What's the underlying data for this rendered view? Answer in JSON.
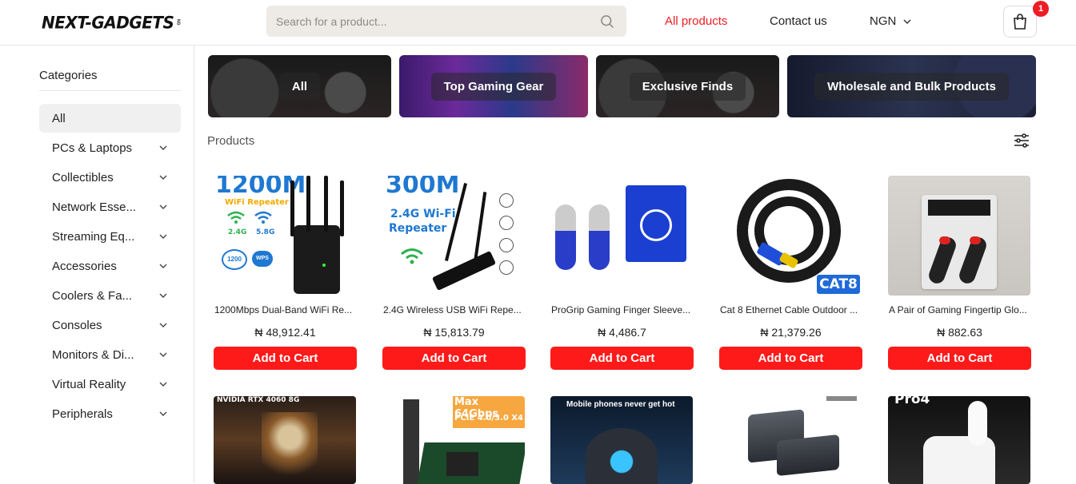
{
  "header": {
    "logo_text": "NEXT-GADGETS",
    "logo_sub": "NG",
    "search_placeholder": "Search for a product...",
    "nav": {
      "all_products": "All products",
      "contact_us": "Contact us"
    },
    "currency": "NGN",
    "cart_count": "1",
    "accent_color": "#ee1c25"
  },
  "sidebar": {
    "title": "Categories",
    "items": [
      {
        "label": "All"
      },
      {
        "label": "PCs & Laptops"
      },
      {
        "label": "Collectibles"
      },
      {
        "label": "Network Esse..."
      },
      {
        "label": "Streaming Eq..."
      },
      {
        "label": "Accessories"
      },
      {
        "label": "Coolers & Fa..."
      },
      {
        "label": "Consoles"
      },
      {
        "label": "Monitors & Di..."
      },
      {
        "label": "Virtual Reality"
      },
      {
        "label": "Peripherals"
      }
    ]
  },
  "banners": [
    {
      "label": "All"
    },
    {
      "label": "Top Gaming Gear"
    },
    {
      "label": "Exclusive Finds"
    },
    {
      "label": "Wholesale and Bulk Products"
    }
  ],
  "products_label": "Products",
  "add_to_cart_label": "Add to Cart",
  "products": [
    {
      "name": "1200Mbps Dual-Band WiFi Re...",
      "price": "₦ 48,912.41",
      "img_text": "1200M",
      "img_sub": "WiFi Repeater",
      "img_24": "2.4G",
      "img_58": "5.8G",
      "img_small": "1200",
      "img_wps": "WPS"
    },
    {
      "name": "2.4G Wireless USB WiFi Repe...",
      "price": "₦ 15,813.79",
      "img_text": "300M",
      "img_sub": "2.4G Wi-Fi",
      "img_sub2": "Repeater"
    },
    {
      "name": "ProGrip Gaming Finger Sleeve...",
      "price": "₦ 4,486.7"
    },
    {
      "name": "Cat 8 Ethernet Cable Outdoor ...",
      "price": "₦ 21,379.26",
      "img_tag": "CAT8"
    },
    {
      "name": "A Pair of Gaming Fingertip Glo...",
      "price": "₦ 882.63"
    }
  ],
  "row2": [
    {
      "img_text": "NVIDIA RTX 4060 8G"
    },
    {
      "img_text": "Max 64Gbps",
      "img_sub": "PCIE 4.0/3.0 X4"
    },
    {
      "img_text": "Mobile phones never get hot"
    },
    {
      "img_text": ""
    },
    {
      "img_text": "Pro4"
    }
  ]
}
